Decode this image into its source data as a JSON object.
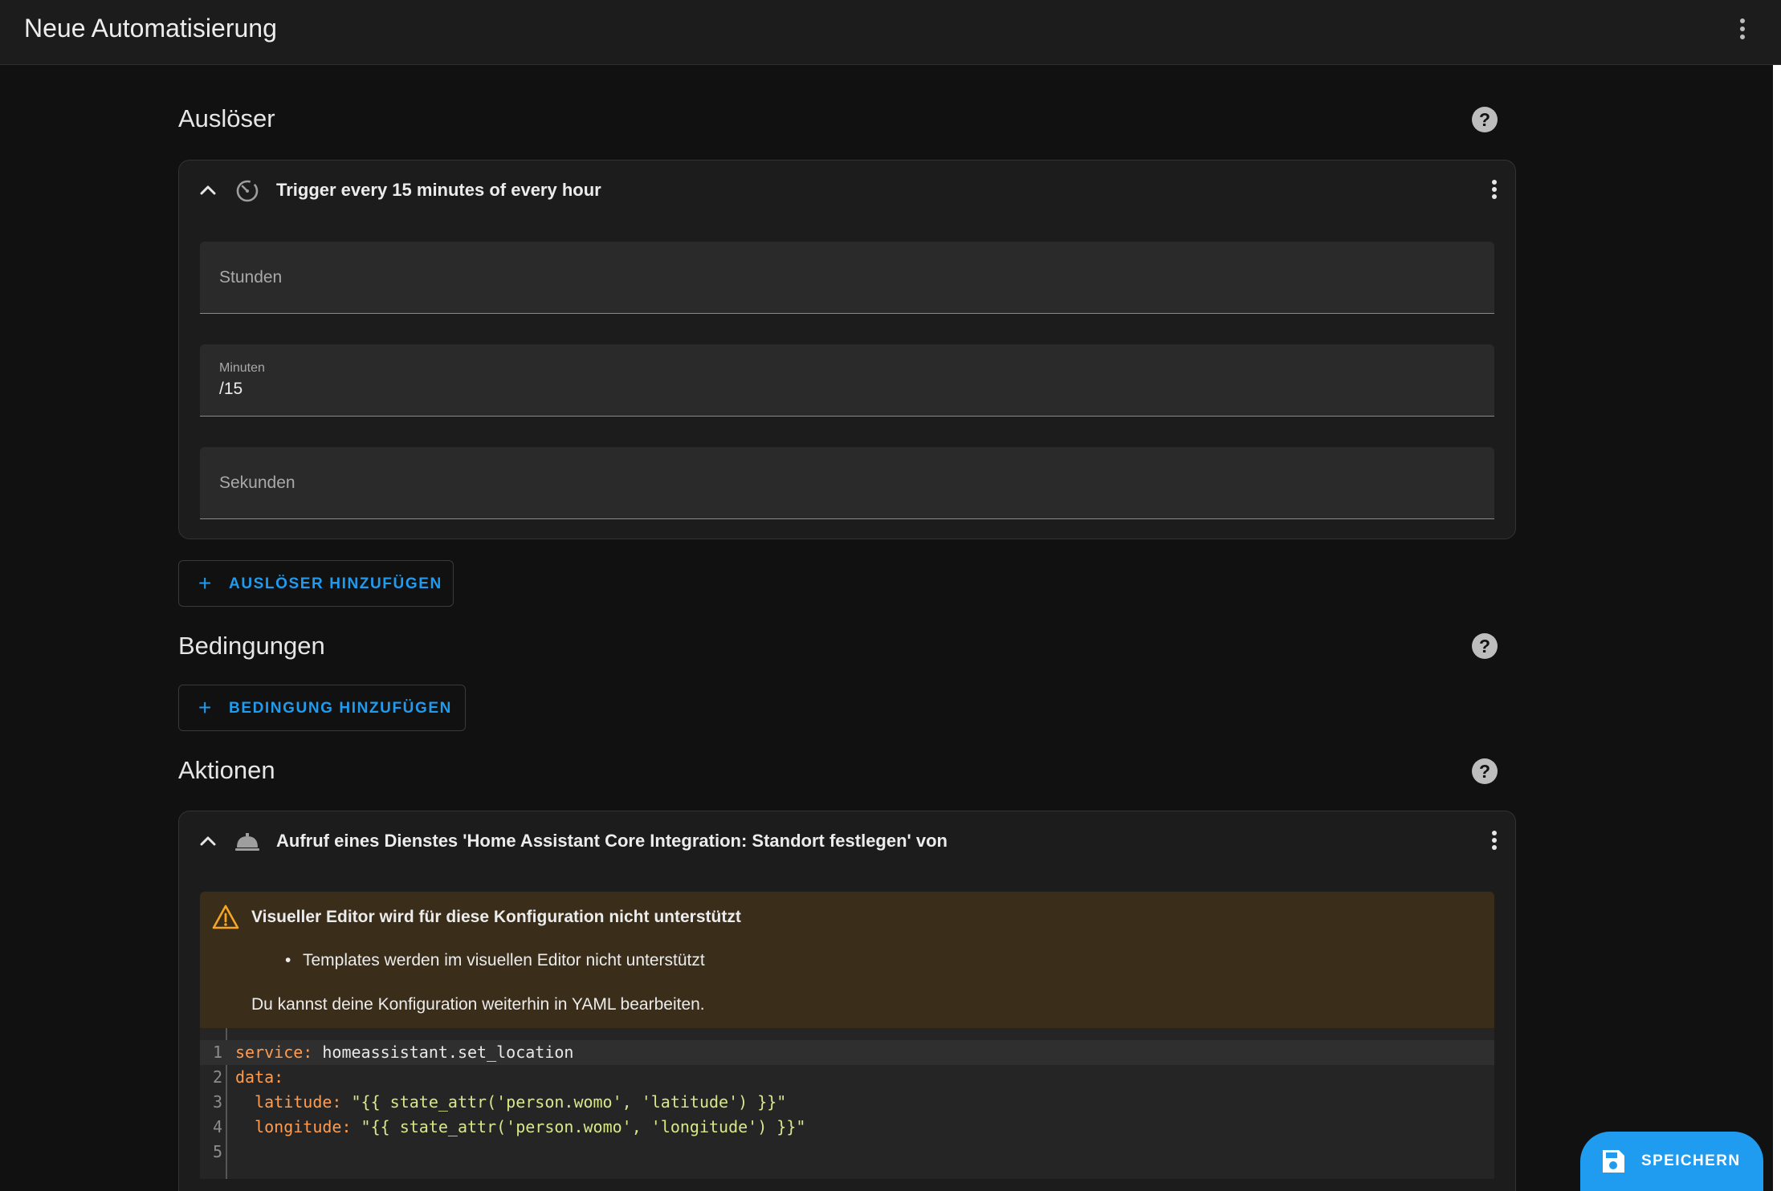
{
  "app": {
    "title": "Neue Automatisierung"
  },
  "triggers": {
    "heading": "Auslöser",
    "card": {
      "title": "Trigger every 15 minutes of every hour",
      "fields": [
        {
          "label": "Stunden",
          "value": ""
        },
        {
          "label": "Minuten",
          "value": "/15"
        },
        {
          "label": "Sekunden",
          "value": ""
        }
      ]
    },
    "add_label": "AUSLÖSER HINZUFÜGEN"
  },
  "conditions": {
    "heading": "Bedingungen",
    "add_label": "BEDINGUNG HINZUFÜGEN"
  },
  "actions": {
    "heading": "Aktionen",
    "card": {
      "title": "Aufruf eines Dienstes 'Home Assistant Core Integration: Standort festlegen' von",
      "warning": {
        "title": "Visueller Editor wird für diese Konfiguration nicht unterstützt",
        "bullet": "Templates werden im visuellen Editor nicht unterstützt",
        "note": "Du kannst deine Konfiguration weiterhin in YAML bearbeiten."
      },
      "code": [
        {
          "num": "1",
          "key": "service:",
          "rest": " homeassistant.set_location"
        },
        {
          "num": "2",
          "key": "data:",
          "rest": ""
        },
        {
          "num": "3",
          "key": "  latitude:",
          "rest": " \"{{ state_attr('person.womo', 'latitude') }}\""
        },
        {
          "num": "4",
          "key": "  longitude:",
          "rest": " \"{{ state_attr('person.womo', 'longitude') }}\""
        },
        {
          "num": "5",
          "key": "",
          "rest": ""
        }
      ]
    }
  },
  "save": {
    "label": "SPEICHERN"
  },
  "colors": {
    "accent": "#1f9bf0",
    "warning_bg": "#3a2d1a",
    "warning_icon": "#f5a623",
    "yaml_key": "#ff9c4f",
    "yaml_string": "#d7e78a"
  }
}
